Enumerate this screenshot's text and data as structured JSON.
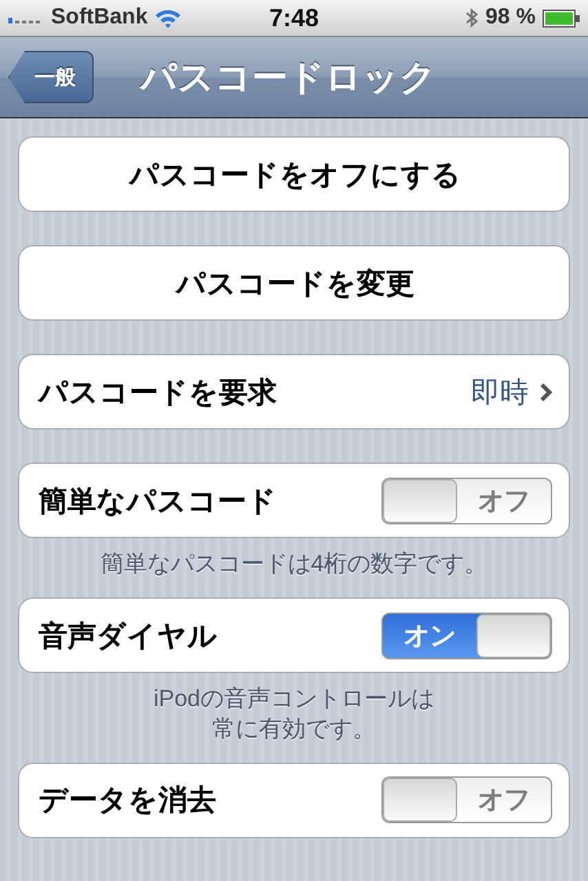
{
  "status_bar": {
    "carrier": "SoftBank",
    "time": "7:48",
    "battery": "98 %"
  },
  "nav_bar": {
    "back": "一般",
    "title": "パスコードロック"
  },
  "groups": [
    {
      "kind": "button",
      "label": "パスコードをオフにする"
    },
    {
      "kind": "button",
      "label": "パスコードを変更"
    },
    {
      "kind": "disclosure",
      "label": "パスコードを要求",
      "value": "即時"
    },
    {
      "kind": "switch",
      "label": "簡単なパスコード",
      "on": false,
      "switch_text": "オフ",
      "footer": [
        "簡単なパスコードは4桁の数字です。"
      ]
    },
    {
      "kind": "switch",
      "label": "音声ダイヤル",
      "on": true,
      "switch_text": "オン",
      "footer": [
        "iPodの音声コントロールは",
        "常に有効です。"
      ]
    },
    {
      "kind": "switch",
      "label": "データを消去",
      "on": false,
      "switch_text": "オフ"
    }
  ]
}
